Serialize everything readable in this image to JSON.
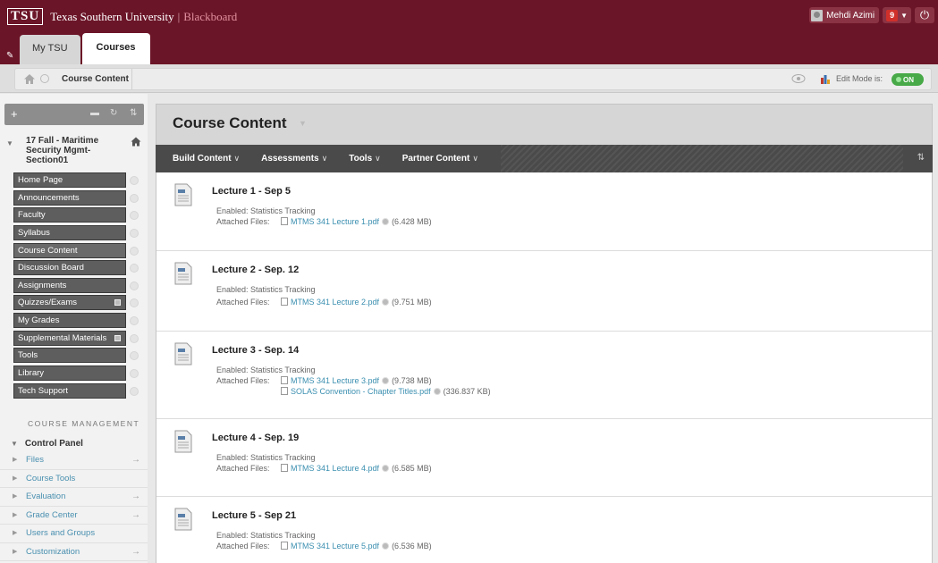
{
  "header": {
    "logo": "TSU",
    "school": "Texas Southern University",
    "separator": "|",
    "product": "Blackboard",
    "user_name": "Mehdi Azimi",
    "notification_count": "9",
    "tabs": [
      {
        "label": "My TSU"
      },
      {
        "label": "Courses"
      }
    ]
  },
  "breadcrumb": {
    "current": "Course Content",
    "edit_mode_label": "Edit Mode is:",
    "edit_mode_value": "ON"
  },
  "sidebar": {
    "course_title": "17 Fall - Maritime Security Mgmt-Section01",
    "menu": [
      {
        "label": "Home Page"
      },
      {
        "label": "Announcements"
      },
      {
        "label": "Faculty"
      },
      {
        "label": "Syllabus"
      },
      {
        "label": "Course Content"
      },
      {
        "label": "Discussion Board"
      },
      {
        "label": "Assignments"
      },
      {
        "label": "Quizzes/Exams"
      },
      {
        "label": "My Grades"
      },
      {
        "label": "Supplemental Materials"
      },
      {
        "label": "Tools"
      },
      {
        "label": "Library"
      },
      {
        "label": "Tech Support"
      }
    ],
    "course_management_label": "COURSE MANAGEMENT",
    "control_panel_label": "Control Panel",
    "control_panel": [
      {
        "label": "Files"
      },
      {
        "label": "Course Tools"
      },
      {
        "label": "Evaluation"
      },
      {
        "label": "Grade Center"
      },
      {
        "label": "Users and Groups"
      },
      {
        "label": "Customization"
      }
    ]
  },
  "main": {
    "title": "Course Content",
    "actions": [
      {
        "label": "Build Content"
      },
      {
        "label": "Assessments"
      },
      {
        "label": "Tools"
      },
      {
        "label": "Partner Content"
      }
    ],
    "enabled_text": "Enabled:  Statistics Tracking",
    "attached_label": "Attached Files:",
    "items": [
      {
        "title": "Lecture 1 - Sep 5",
        "files": [
          {
            "name": "MTMS 341 Lecture 1.pdf",
            "size": "(6.428 MB)"
          }
        ]
      },
      {
        "title": "Lecture 2 - Sep. 12",
        "files": [
          {
            "name": "MTMS 341 Lecture 2.pdf",
            "size": "(9.751 MB)"
          }
        ]
      },
      {
        "title": "Lecture 3 - Sep. 14",
        "files": [
          {
            "name": "MTMS 341 Lecture 3.pdf",
            "size": "(9.738 MB)"
          },
          {
            "name": "SOLAS Convention - Chapter Titles.pdf",
            "size": "(336.837 KB)"
          }
        ]
      },
      {
        "title": "Lecture 4 - Sep. 19",
        "files": [
          {
            "name": "MTMS 341 Lecture 4.pdf",
            "size": "(6.585 MB)"
          }
        ]
      },
      {
        "title": "Lecture 5 - Sep 21",
        "files": [
          {
            "name": "MTMS 341 Lecture 5.pdf",
            "size": "(6.536 MB)"
          }
        ]
      }
    ]
  },
  "colors": {
    "banner": "#6b1528",
    "link": "#3b8fb0",
    "toggle_on": "#47a947"
  }
}
